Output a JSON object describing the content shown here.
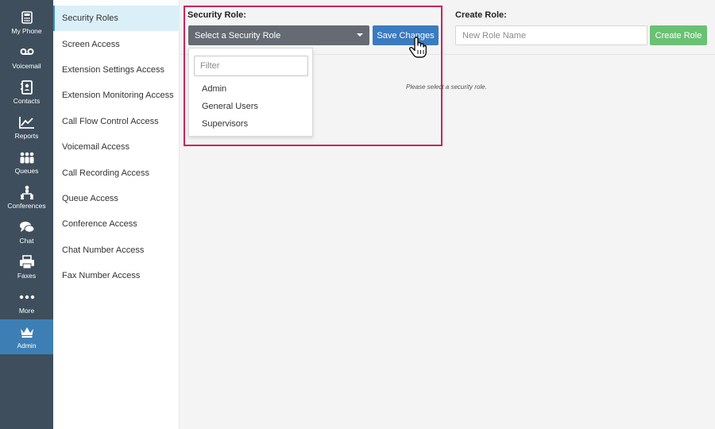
{
  "rail": {
    "items": [
      {
        "label": "My Phone",
        "icon": "phone-icon"
      },
      {
        "label": "Voicemail",
        "icon": "voicemail-icon"
      },
      {
        "label": "Contacts",
        "icon": "contacts-icon"
      },
      {
        "label": "Reports",
        "icon": "reports-icon"
      },
      {
        "label": "Queues",
        "icon": "queues-icon"
      },
      {
        "label": "Conferences",
        "icon": "conferences-icon"
      },
      {
        "label": "Chat",
        "icon": "chat-icon"
      },
      {
        "label": "Faxes",
        "icon": "fax-icon"
      },
      {
        "label": "More",
        "icon": "more-icon"
      },
      {
        "label": "Admin",
        "icon": "crown-icon",
        "active": true
      }
    ]
  },
  "submenu": {
    "items": [
      {
        "label": "Security Roles",
        "active": true
      },
      {
        "label": "Screen Access"
      },
      {
        "label": "Extension Settings Access"
      },
      {
        "label": "Extension Monitoring Access"
      },
      {
        "label": "Call Flow Control Access"
      },
      {
        "label": "Voicemail Access"
      },
      {
        "label": "Call Recording Access"
      },
      {
        "label": "Queue Access"
      },
      {
        "label": "Conference Access"
      },
      {
        "label": "Chat Number Access"
      },
      {
        "label": "Fax Number Access"
      }
    ]
  },
  "security_role": {
    "label": "Security Role:",
    "select_value": "Select a Security Role",
    "save_button": "Save Changes",
    "dropdown": {
      "filter_placeholder": "Filter",
      "options": [
        "Admin",
        "General Users",
        "Supervisors"
      ]
    }
  },
  "create_role": {
    "label": "Create Role:",
    "input_placeholder": "New Role Name",
    "button": "Create Role"
  },
  "hint": "Please select a security role.",
  "colors": {
    "rail_bg": "#3e4e5c",
    "rail_active": "#3d7fb5",
    "submenu_active": "#dbeff9",
    "save_button": "#3b7bc0",
    "create_button": "#6ac174",
    "highlight_border": "#c9245d"
  }
}
